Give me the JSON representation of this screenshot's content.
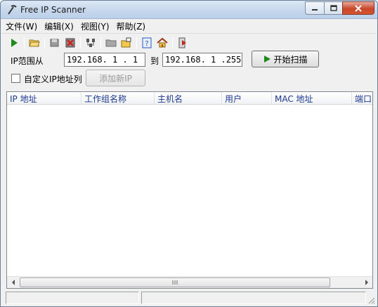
{
  "window": {
    "title": "Free IP Scanner"
  },
  "menu": [
    "文件(W)",
    "编辑(X)",
    "视图(Y)",
    "帮助(Z)"
  ],
  "toolbar": {
    "icons": [
      "play-icon",
      "open-folder-icon",
      "save-icon",
      "delete-icon",
      "network-icon",
      "folder-icon",
      "export-icon",
      "help-icon",
      "home-icon",
      "exit-icon"
    ]
  },
  "scan": {
    "ip_range_label": "IP范围从",
    "start_ip": "192.168. 1 . 1",
    "to_label": "到",
    "end_ip": "192.168. 1 .255",
    "start_button": "开始扫描",
    "custom_ip_label": "自定义IP地址列",
    "add_ip_button": "添加新IP"
  },
  "table": {
    "columns": [
      "IP 地址",
      "工作组名称",
      "主机名",
      "用户",
      "MAC 地址",
      "端口"
    ]
  },
  "colors": {
    "play_green": "#1e8a1e",
    "header_text": "#1d3a8f",
    "close_red": "#c9462c"
  }
}
